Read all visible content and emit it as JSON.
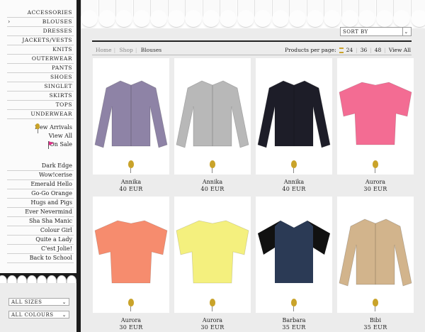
{
  "sidebar": {
    "categories": [
      {
        "label": "ACCESSORIES",
        "active": false
      },
      {
        "label": "BLOUSES",
        "active": true
      },
      {
        "label": "DRESSES",
        "active": false
      },
      {
        "label": "JACKETS/VESTS",
        "active": false
      },
      {
        "label": "KNITS",
        "active": false
      },
      {
        "label": "OUTERWEAR",
        "active": false
      },
      {
        "label": "PANTS",
        "active": false
      },
      {
        "label": "SHOES",
        "active": false
      },
      {
        "label": "SINGLET",
        "active": false
      },
      {
        "label": "SKIRTS",
        "active": false
      },
      {
        "label": "TOPS",
        "active": false
      },
      {
        "label": "UNDERWEAR",
        "active": false
      }
    ],
    "new_arrivals": "New Arrivals",
    "view_all": "View All",
    "on_sale": "On Sale",
    "trends": [
      "Dark Edge",
      "Wow!cerise",
      "Emerald Hello",
      "Go-Go Orange",
      "Hugs and Pigs",
      "Ever Nevermind",
      "Sha Sha Manic",
      "Colour Girl",
      "Quite a Lady",
      "C'est Jolie!",
      "Back to School"
    ],
    "filters": {
      "sizes": "ALL SIZES",
      "colours": "ALL COLOURS"
    }
  },
  "toolbar": {
    "sort_by": "SORT BY",
    "breadcrumb": [
      "Home",
      "Shop",
      "Blouses"
    ],
    "products_per_page_label": "Products per page:",
    "per_page_options": [
      "24",
      "36",
      "48",
      "View All"
    ]
  },
  "products": [
    {
      "name": "Annika",
      "price": "40 EUR",
      "color": "#8e83a6",
      "style": "button"
    },
    {
      "name": "Annika",
      "price": "40 EUR",
      "color": "#b8b8b8",
      "style": "button"
    },
    {
      "name": "Annika",
      "price": "40 EUR",
      "color": "#1d1d28",
      "style": "button"
    },
    {
      "name": "Aurora",
      "price": "30 EUR",
      "color": "#f36c93",
      "style": "tee"
    },
    {
      "name": "Aurora",
      "price": "30 EUR",
      "color": "#f68c6e",
      "style": "tee"
    },
    {
      "name": "Aurora",
      "price": "30 EUR",
      "color": "#f4f07e",
      "style": "tee"
    },
    {
      "name": "Barbara",
      "price": "35 EUR",
      "color": "#2b3a55",
      "style": "tee-dark"
    },
    {
      "name": "Bibi",
      "price": "35 EUR",
      "color": "#d2b48c",
      "style": "button"
    }
  ],
  "icons": {
    "price_marker": "balloon-icon",
    "new_arrivals": "balloon-icon",
    "on_sale": "flag-icon",
    "dropdown": "chevron-down-icon"
  }
}
